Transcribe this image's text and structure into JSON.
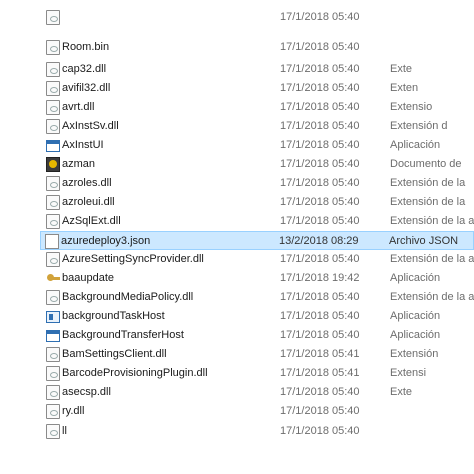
{
  "rows": [
    {
      "name": "",
      "date": "17/1/2018 05:40",
      "type": "",
      "icon": "dll-icon"
    },
    {
      "name": "Room.bin",
      "date": "17/1/2018 05:40",
      "type": "",
      "icon": "dll-icon"
    },
    {
      "name": "cap32.dll",
      "date": "17/1/2018 05:40",
      "type": "Exte",
      "icon": "dll-icon"
    },
    {
      "name": "avifil32.dll",
      "date": "17/1/2018 05:40",
      "type": "Exten",
      "icon": "dll-icon"
    },
    {
      "name": "avrt.dll",
      "date": "17/1/2018 05:40",
      "type": "Extensio",
      "icon": "dll-icon"
    },
    {
      "name": "AxInstSv.dll",
      "date": "17/1/2018 05:40",
      "type": "Extensión d",
      "icon": "dll-icon"
    },
    {
      "name": "AxInstUI",
      "date": "17/1/2018 05:40",
      "type": "Aplicación",
      "icon": "application-icon"
    },
    {
      "name": "azman",
      "date": "17/1/2018 05:40",
      "type": "Documento de",
      "icon": "management-console-icon"
    },
    {
      "name": "azroles.dll",
      "date": "17/1/2018 05:40",
      "type": "Extensión de la",
      "icon": "dll-icon"
    },
    {
      "name": "azroleui.dll",
      "date": "17/1/2018 05:40",
      "type": "Extensión de la",
      "icon": "dll-icon"
    },
    {
      "name": "AzSqlExt.dll",
      "date": "17/1/2018 05:40",
      "type": "Extensión de la a",
      "icon": "dll-icon"
    },
    {
      "name": "azuredeploy3.json",
      "date": "13/2/2018 08:29",
      "type": "Archivo JSON",
      "icon": "json-file-icon",
      "selected": true
    },
    {
      "name": "AzureSettingSyncProvider.dll",
      "date": "17/1/2018 05:40",
      "type": "Extensión de la a",
      "icon": "dll-icon"
    },
    {
      "name": "baaupdate",
      "date": "17/1/2018 19:42",
      "type": "Aplicación",
      "icon": "keys-icon"
    },
    {
      "name": "BackgroundMediaPolicy.dll",
      "date": "17/1/2018 05:40",
      "type": "Extensión de la a",
      "icon": "dll-icon"
    },
    {
      "name": "backgroundTaskHost",
      "date": "17/1/2018 05:40",
      "type": "Aplicación",
      "icon": "application-icon"
    },
    {
      "name": "BackgroundTransferHost",
      "date": "17/1/2018 05:40",
      "type": "Aplicación",
      "icon": "application-icon"
    },
    {
      "name": "BamSettingsClient.dll",
      "date": "17/1/2018 05:41",
      "type": "Extensión",
      "icon": "dll-icon"
    },
    {
      "name": "BarcodeProvisioningPlugin.dll",
      "date": "17/1/2018 05:41",
      "type": "Extensi",
      "icon": "dll-icon"
    },
    {
      "name": "asecsp.dll",
      "date": "17/1/2018 05:40",
      "type": "Exte",
      "icon": "dll-icon"
    },
    {
      "name": "ry.dll",
      "date": "17/1/2018 05:40",
      "type": "",
      "icon": "dll-icon"
    },
    {
      "name": "ll",
      "date": "17/1/2018 05:40",
      "type": "",
      "icon": "dll-icon"
    }
  ],
  "colors": {
    "selection_bg": "#cce8ff",
    "selection_border": "#99d1ff"
  }
}
